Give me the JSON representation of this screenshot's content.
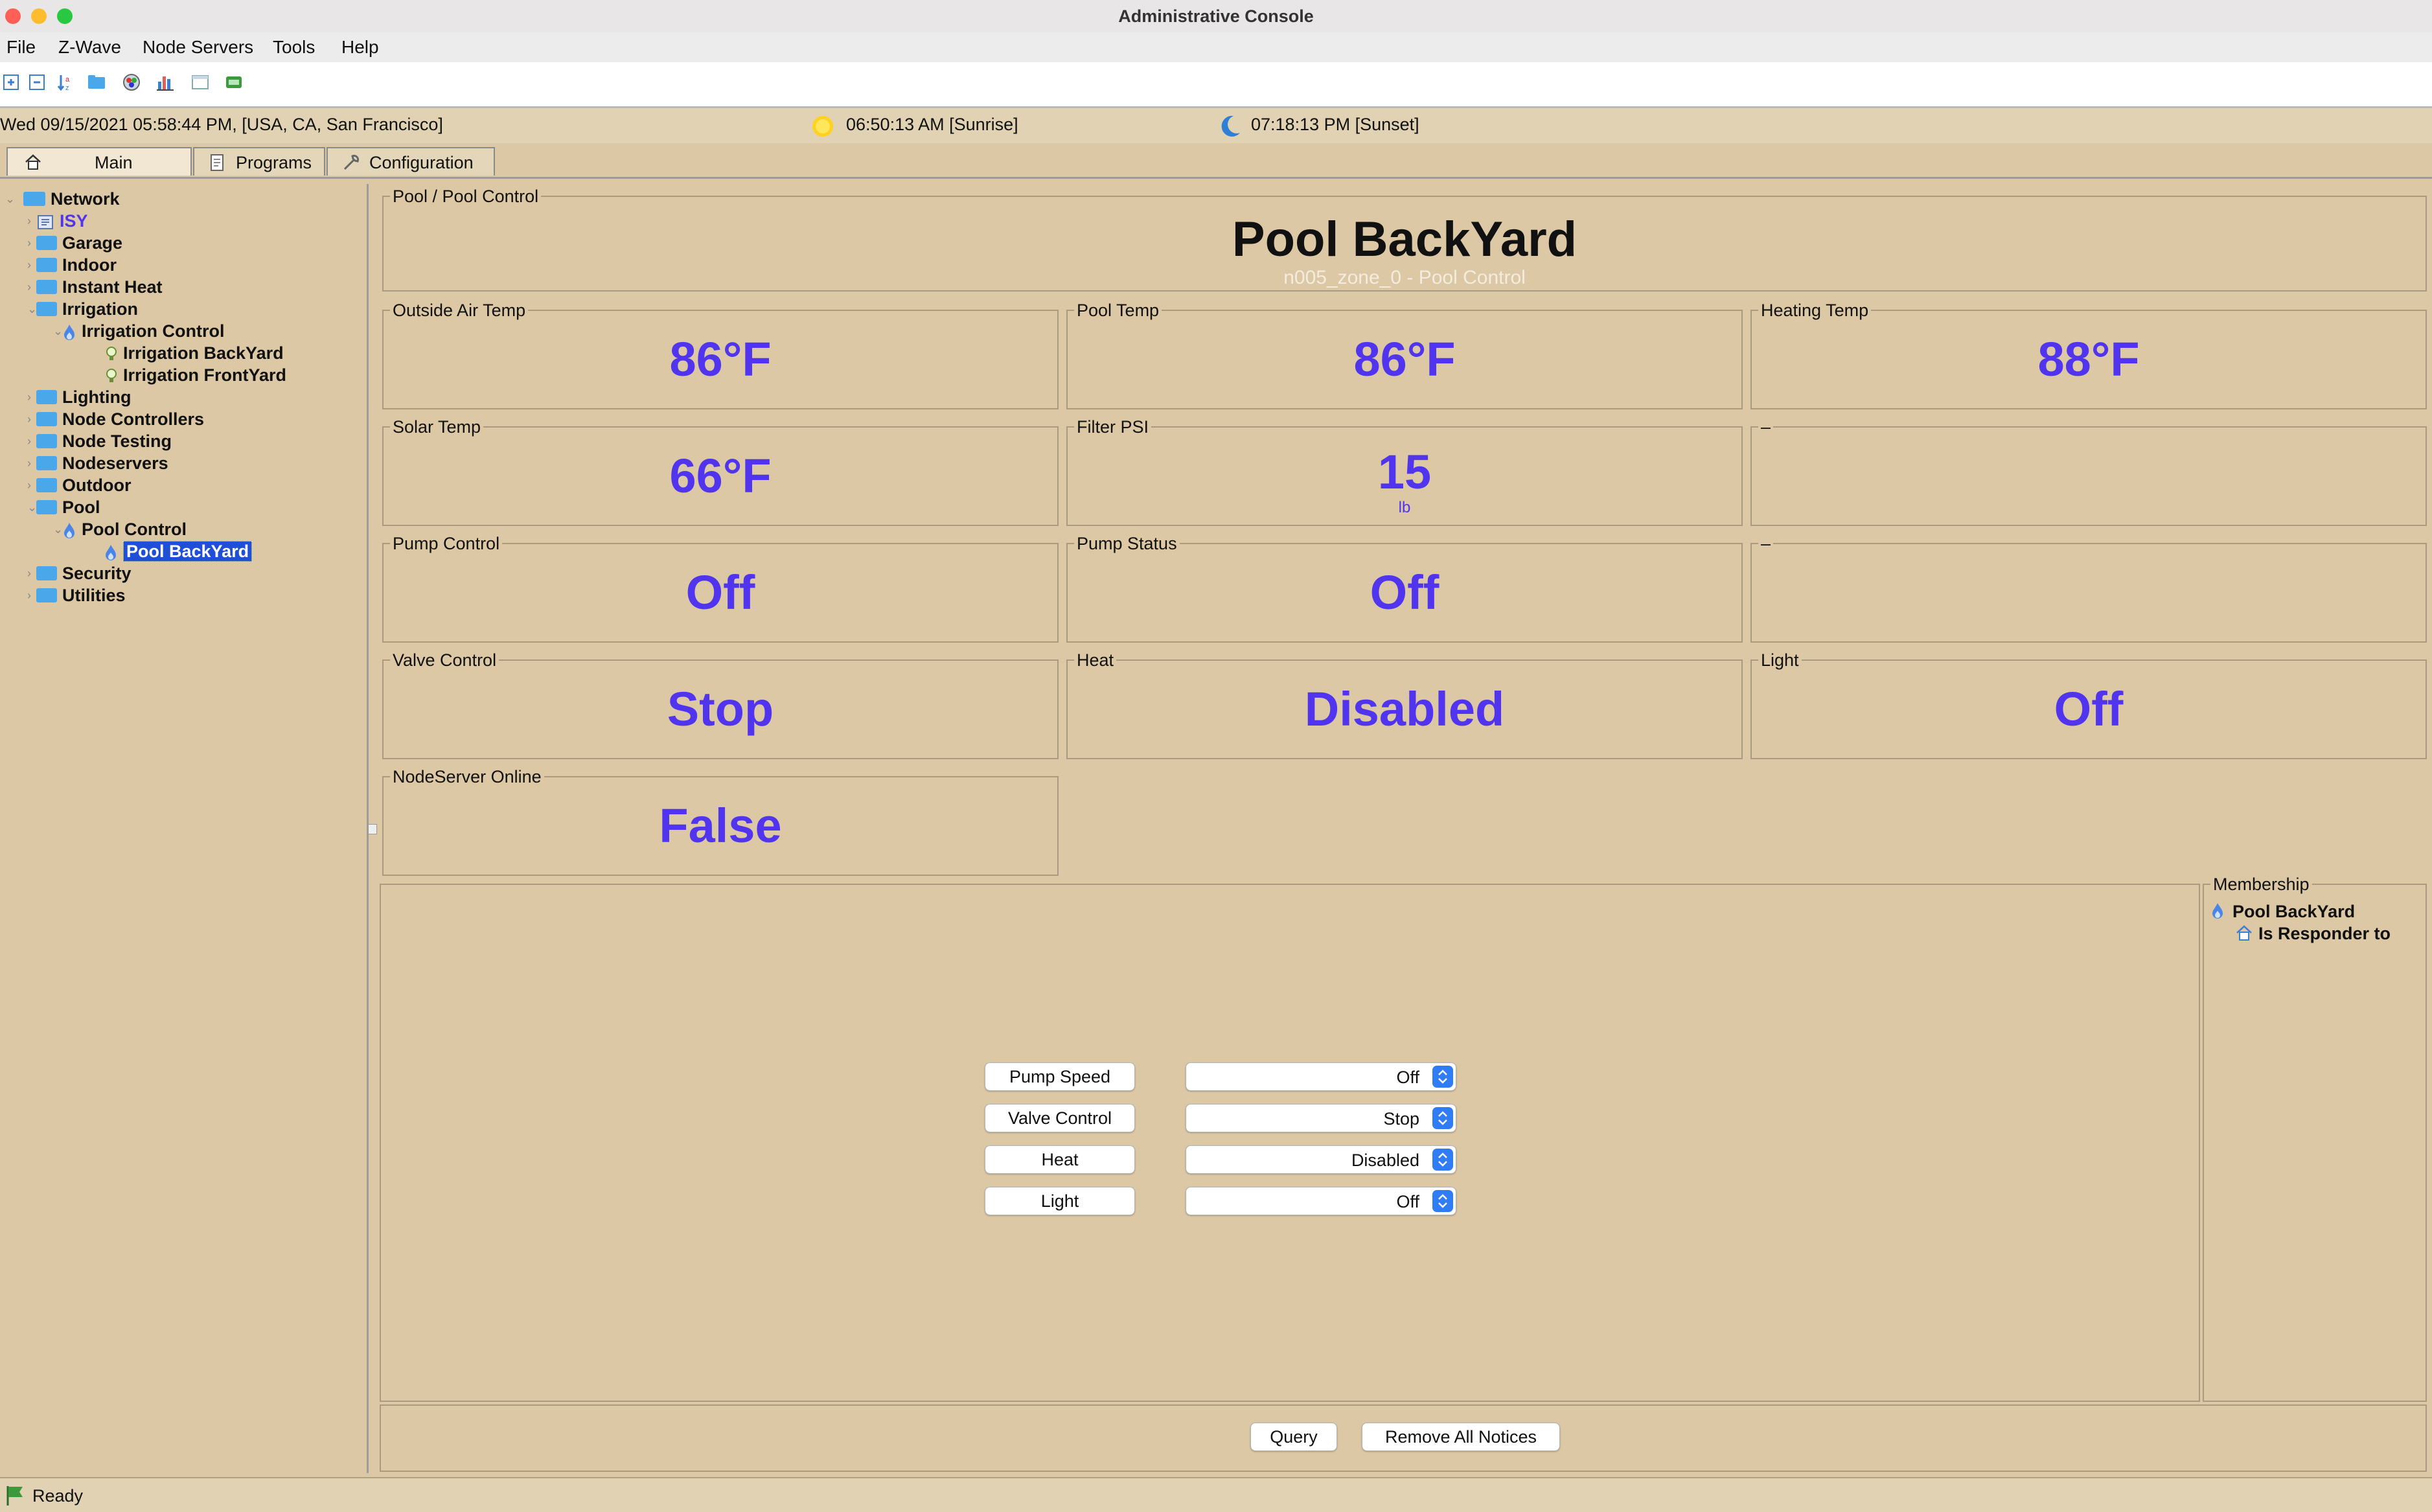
{
  "window": {
    "title": "Administrative Console"
  },
  "menubar": {
    "items": [
      "File",
      "Z-Wave",
      "Node Servers",
      "Tools",
      "Help"
    ]
  },
  "infobar": {
    "datetime": "Wed 09/15/2021 05:58:44 PM,  [USA, CA, San Francisco]",
    "sunrise": "06:50:13 AM [Sunrise]",
    "sunset": "07:18:13 PM [Sunset]"
  },
  "tabs": {
    "main": "Main",
    "programs": "Programs",
    "configuration": "Configuration"
  },
  "tree": {
    "root": "Network",
    "isy": "ISY",
    "garage": "Garage",
    "indoor": "Indoor",
    "instant_heat": "Instant Heat",
    "irrigation": "Irrigation",
    "irrigation_control": "Irrigation Control",
    "irrigation_backyard": "Irrigation BackYard",
    "irrigation_frontyard": "Irrigation FrontYard",
    "lighting": "Lighting",
    "node_controllers": "Node Controllers",
    "node_testing": "Node Testing",
    "nodeservers": "Nodeservers",
    "outdoor": "Outdoor",
    "pool": "Pool",
    "pool_control": "Pool Control",
    "pool_backyard": "Pool BackYard",
    "security": "Security",
    "utilities": "Utilities"
  },
  "header": {
    "breadcrumb": "Pool / Pool Control",
    "title": "Pool BackYard",
    "subtitle": "n005_zone_0 - Pool Control"
  },
  "cells": {
    "outside_air_temp": {
      "label": "Outside Air Temp",
      "value": "86°F"
    },
    "pool_temp": {
      "label": "Pool Temp",
      "value": "86°F"
    },
    "heating_temp": {
      "label": "Heating Temp",
      "value": "88°F"
    },
    "solar_temp": {
      "label": "Solar Temp",
      "value": "66°F"
    },
    "filter_psi": {
      "label": "Filter PSI",
      "value": "15",
      "unit": "lb"
    },
    "empty1": {
      "label": "–"
    },
    "pump_control": {
      "label": "Pump Control",
      "value": "Off"
    },
    "pump_status": {
      "label": "Pump Status",
      "value": "Off"
    },
    "empty2": {
      "label": "–"
    },
    "valve_control": {
      "label": "Valve Control",
      "value": "Stop"
    },
    "heat": {
      "label": "Heat",
      "value": "Disabled"
    },
    "light": {
      "label": "Light",
      "value": "Off"
    },
    "nodeserver_online": {
      "label": "NodeServer Online",
      "value": "False"
    }
  },
  "controls": [
    {
      "button": "Pump Speed",
      "value": "Off"
    },
    {
      "button": "Valve Control",
      "value": "Stop"
    },
    {
      "button": "Heat",
      "value": "Disabled"
    },
    {
      "button": "Light",
      "value": "Off"
    }
  ],
  "membership": {
    "title": "Membership",
    "node": "Pool BackYard",
    "relation": "Is Responder to"
  },
  "actions": {
    "query": "Query",
    "remove_notices": "Remove All Notices"
  },
  "status": {
    "text": "Ready"
  },
  "colors": {
    "value_blue": "#5135ee",
    "background": "#dcc8a4",
    "selection": "#1e4fd6"
  }
}
